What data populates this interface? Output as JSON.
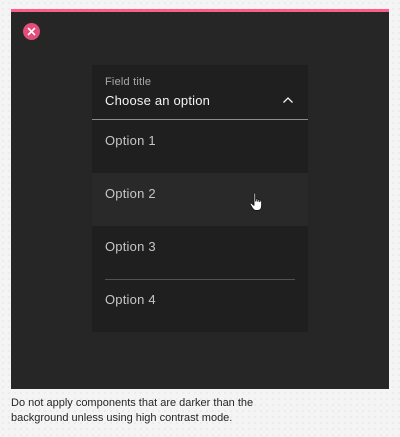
{
  "dropdown": {
    "field_title": "Field title",
    "value": "Choose an option",
    "options": [
      {
        "label": "Option 1"
      },
      {
        "label": "Option 2"
      },
      {
        "label": "Option 3"
      },
      {
        "label": "Option 4"
      }
    ],
    "hovered_option": "Option 2"
  },
  "caption": {
    "line1": "Do not apply components that are darker than the",
    "line2": "background unless using high contrast mode."
  },
  "colors": {
    "accent": "#ff5c8a",
    "badge": "#e24e7b",
    "canvas": "#262626",
    "field": "#1f1f1f"
  },
  "icons": {
    "badge": "close-icon",
    "chevron": "chevron-up-icon",
    "cursor": "hand-pointer-icon"
  }
}
